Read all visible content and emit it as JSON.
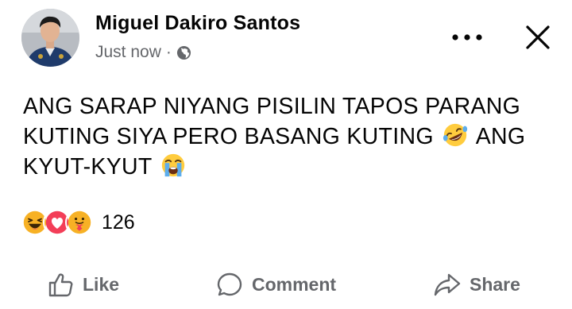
{
  "post": {
    "author": "Miguel Dakiro Santos",
    "timestamp": "Just now",
    "separator": "·",
    "audience_icon": "globe-icon",
    "text_line1": "ANG SARAP NIYANG PISILIN TAPOS PARANG",
    "text_line2a": "KUTING SIYA PERO BASANG KUTING",
    "text_line2b": "ANG",
    "text_line3": "KYUT-KYUT",
    "emojis": [
      "rolling-on-floor-laughing-emoji",
      "loudly-crying-emoji"
    ]
  },
  "header": {
    "more_icon": "more-icon",
    "close_icon": "close-icon"
  },
  "reactions": {
    "types": [
      "haha",
      "love",
      "care"
    ],
    "count": "126"
  },
  "actions": {
    "like": "Like",
    "comment": "Comment",
    "share": "Share"
  },
  "colors": {
    "text_primary": "#050505",
    "text_secondary": "#65676b",
    "love": "#f33e58",
    "haha": "#f7b125"
  }
}
